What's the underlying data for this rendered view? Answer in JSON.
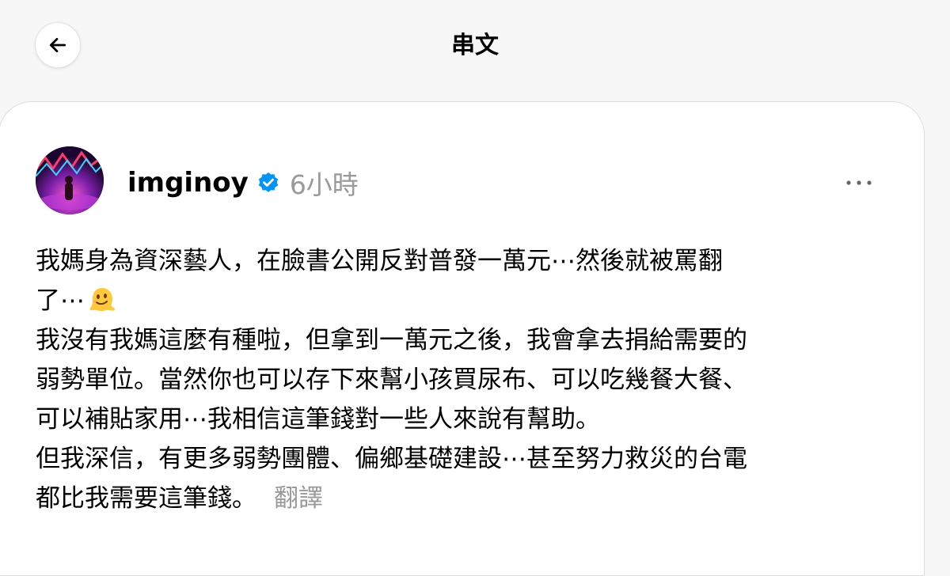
{
  "header": {
    "title": "串文",
    "back_icon": "arrow-left-icon"
  },
  "post": {
    "username": "imginoy",
    "verified_icon": "verified-badge-icon",
    "timestamp": "6小時",
    "more_icon": "more-horizontal-icon",
    "lines": [
      "我媽身為資深藝人，在臉書公開反對普發一萬元⋯然後就被罵翻",
      "了⋯",
      "我沒有我媽這麼有種啦，但拿到一萬元之後，我會拿去捐給需要的",
      "弱勢單位。當然你也可以存下來幫小孩買尿布、可以吃幾餐大餐、",
      "可以補貼家用⋯我相信這筆錢對一些人來說有幫助。",
      "但我深信，有更多弱勢團體、偏鄉基礎建設⋯甚至努力救災的台電",
      "都比我需要這筆錢。"
    ],
    "emoji": "melting-face-emoji",
    "translate_label": "翻譯"
  },
  "colors": {
    "background": "#f7f7f7",
    "card": "#ffffff",
    "muted_text": "#999999",
    "verified_blue": "#0095f6"
  }
}
